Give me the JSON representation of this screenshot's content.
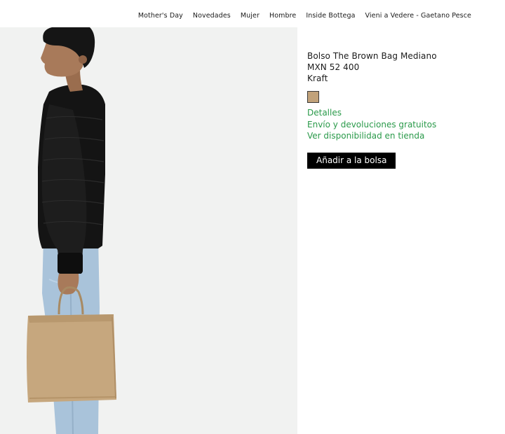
{
  "nav": {
    "items": [
      {
        "label": "Mother's Day"
      },
      {
        "label": "Novedades"
      },
      {
        "label": "Mujer"
      },
      {
        "label": "Hombre"
      },
      {
        "label": "Inside Bottega"
      },
      {
        "label": "Vieni a Vedere - Gaetano Pesce"
      }
    ]
  },
  "product": {
    "name": "Bolso The Brown Bag Mediano",
    "price": "MXN 52 400",
    "color_name": "Kraft",
    "swatch_color": "#c1a27a",
    "links": {
      "details": "Detalles",
      "shipping": "Envío y devoluciones gratuitos",
      "availability": "Ver disponibilidad en tienda"
    },
    "add_to_bag": "Añadir a la bolsa"
  },
  "colors": {
    "link_green": "#2a9a4a",
    "image_background": "#f1f2f1",
    "button_background": "#000000"
  }
}
